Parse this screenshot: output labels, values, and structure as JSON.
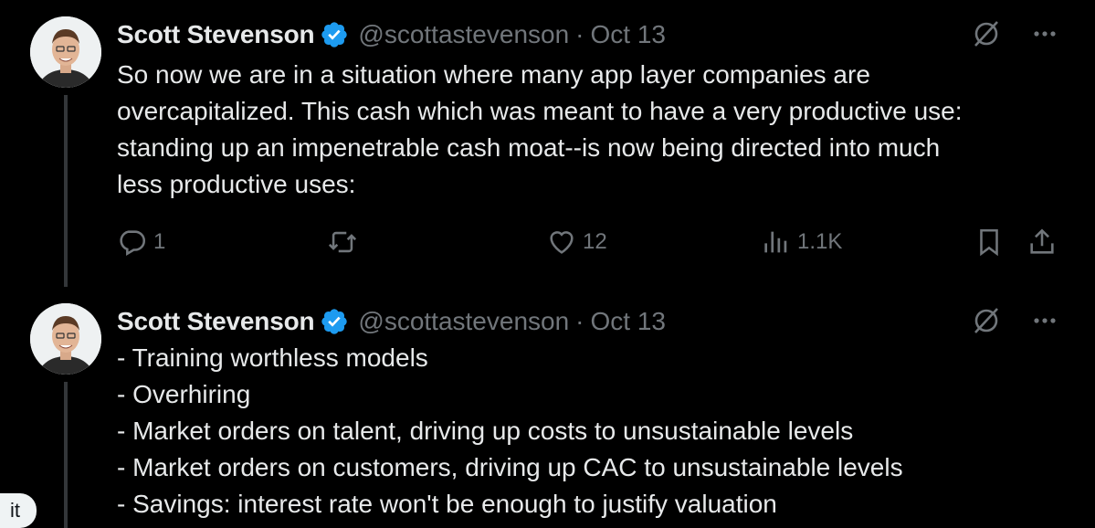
{
  "tweets": [
    {
      "author_name": "Scott Stevenson",
      "handle": "@scottastevenson",
      "separator": "·",
      "date": "Oct 13",
      "text": "So now we are in a situation where many app layer companies are\novercapitalized. This cash which was meant to have a very productive use:\nstanding up an impenetrable cash moat--is now being directed into much\nless productive uses:",
      "reply_count": "1",
      "retweet_count": "",
      "like_count": "12",
      "view_count": "1.1K"
    },
    {
      "author_name": "Scott Stevenson",
      "handle": "@scottastevenson",
      "separator": "·",
      "date": "Oct 13",
      "text": "- Training worthless models\n- Overhiring\n- Market orders on talent, driving up costs to unsustainable levels\n- Market orders on customers, driving up CAC to unsustainable levels\n- Savings: interest rate won't be enough to justify valuation"
    }
  ],
  "side_pill_text": "it",
  "icons": {
    "verified": "verified-badge-icon",
    "grok": "grok-icon",
    "more": "more-icon",
    "reply": "reply-icon",
    "retweet": "retweet-icon",
    "like": "heart-icon",
    "views": "views-icon",
    "bookmark": "bookmark-icon",
    "share": "share-icon"
  },
  "colors": {
    "background": "#000000",
    "text": "#e7e9ea",
    "secondary": "#71767b",
    "verified_blue": "#1d9bf0",
    "thread_line": "#333639"
  }
}
